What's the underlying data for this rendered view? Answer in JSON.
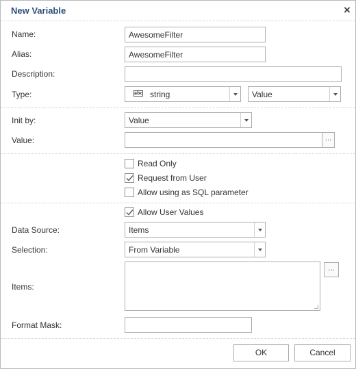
{
  "dialog": {
    "title": "New Variable",
    "close_glyph": "×"
  },
  "labels": {
    "name": "Name:",
    "alias": "Alias:",
    "description": "Description:",
    "type": "Type:",
    "init_by": "Init by:",
    "value": "Value:",
    "data_source": "Data Source:",
    "selection": "Selection:",
    "items": "Items:",
    "format_mask": "Format Mask:"
  },
  "fields": {
    "name": "AwesomeFilter",
    "alias": "AwesomeFilter",
    "description": "",
    "type": "string",
    "type_icon": "abc",
    "type_mode": "Value",
    "init_by": "Value",
    "value": "",
    "data_source": "Items",
    "selection": "From Variable",
    "items": "",
    "format_mask": ""
  },
  "checkboxes": {
    "read_only": {
      "label": "Read Only",
      "checked": false
    },
    "request_from_user": {
      "label": "Request from User",
      "checked": true
    },
    "allow_sql": {
      "label": "Allow using as SQL parameter",
      "checked": false
    },
    "allow_user_values": {
      "label": "Allow User Values",
      "checked": true
    }
  },
  "buttons": {
    "ellipsis": "...",
    "ok": "OK",
    "cancel": "Cancel"
  },
  "icons": {
    "close": "close-icon",
    "dropdown": "chevron-down-icon",
    "check": "check-icon",
    "type": "abc-type-icon"
  }
}
